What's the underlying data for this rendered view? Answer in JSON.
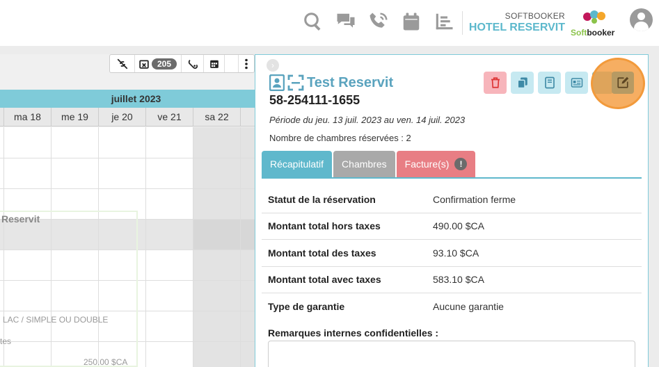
{
  "header": {
    "brand_sub": "SOFTBOOKER",
    "brand_main": "HOTEL RESERVIT",
    "logo_text_a": "Soft",
    "logo_text_b": "booker",
    "icons": [
      "search-icon",
      "chat-icon",
      "phone-icon",
      "calendar-icon",
      "list-icon"
    ]
  },
  "calendar": {
    "toolbar": {
      "count": "205"
    },
    "month": "juillet 2023",
    "days": [
      "ma 18",
      "me 19",
      "je 20",
      "ve 21",
      "sa 22"
    ],
    "reservation_label": "Reservit",
    "room_type": "LAC / SIMPLE OU DOUBLE",
    "small_text": "tes",
    "price": "250.00 $CA"
  },
  "panel": {
    "title": "Test Reservit",
    "reservation_number": "58-254111-1655",
    "period": "Période du jeu. 13 juil. 2023 au ven. 14 juil. 2023",
    "rooms_count": "Nombre de chambres réservées : 2",
    "tabs": {
      "recap": "Récapitulatif",
      "rooms": "Chambres",
      "invoices": "Facture(s)",
      "invoices_badge": "!"
    },
    "info": [
      {
        "label": "Statut de la réservation",
        "value": "Confirmation ferme"
      },
      {
        "label": "Montant total hors taxes",
        "value": "490.00 $CA"
      },
      {
        "label": "Montant total des taxes",
        "value": "93.10 $CA"
      },
      {
        "label": "Montant total avec taxes",
        "value": "583.10 $CA"
      },
      {
        "label": "Type de garantie",
        "value": "Aucune garantie"
      }
    ],
    "remarks_label": "Remarques internes confidentielles :"
  },
  "colors": {
    "accent": "#5fb8cc",
    "delete": "#f7b5bb",
    "invoice_tab": "#e87e84",
    "rooms_tab": "#a9a9a9",
    "highlight": "#f29a3b"
  }
}
